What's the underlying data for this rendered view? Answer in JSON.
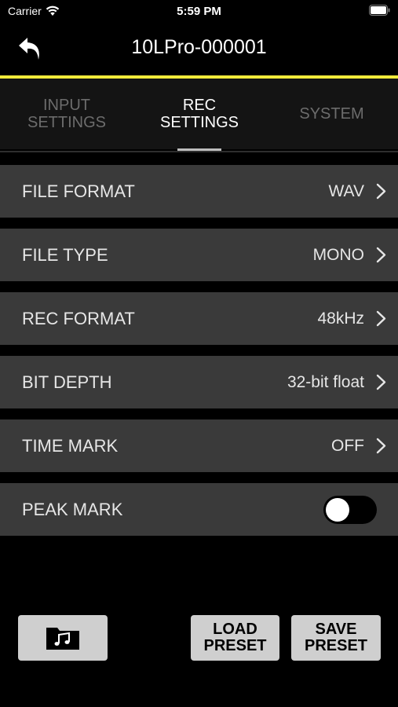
{
  "status_bar": {
    "carrier": "Carrier",
    "time": "5:59 PM"
  },
  "header": {
    "title": "10LPro-000001",
    "back_icon": "back-arrow-icon",
    "accent_color": "#f1ea3a"
  },
  "tabs": [
    {
      "label": "INPUT\nSETTINGS",
      "active": false
    },
    {
      "label": "REC\nSETTINGS",
      "active": true
    },
    {
      "label": "SYSTEM",
      "active": false
    }
  ],
  "settings": {
    "file_format": {
      "label": "FILE FORMAT",
      "value": "WAV"
    },
    "file_type": {
      "label": "FILE TYPE",
      "value": "MONO"
    },
    "rec_format": {
      "label": "REC FORMAT",
      "value": "48kHz"
    },
    "bit_depth": {
      "label": "BIT DEPTH",
      "value": "32-bit float"
    },
    "time_mark": {
      "label": "TIME MARK",
      "value": "OFF"
    },
    "peak_mark": {
      "label": "PEAK MARK",
      "enabled": false
    }
  },
  "footer": {
    "music_button_icon": "music-folder-icon",
    "load_preset": "LOAD\nPRESET",
    "save_preset": "SAVE\nPRESET"
  }
}
